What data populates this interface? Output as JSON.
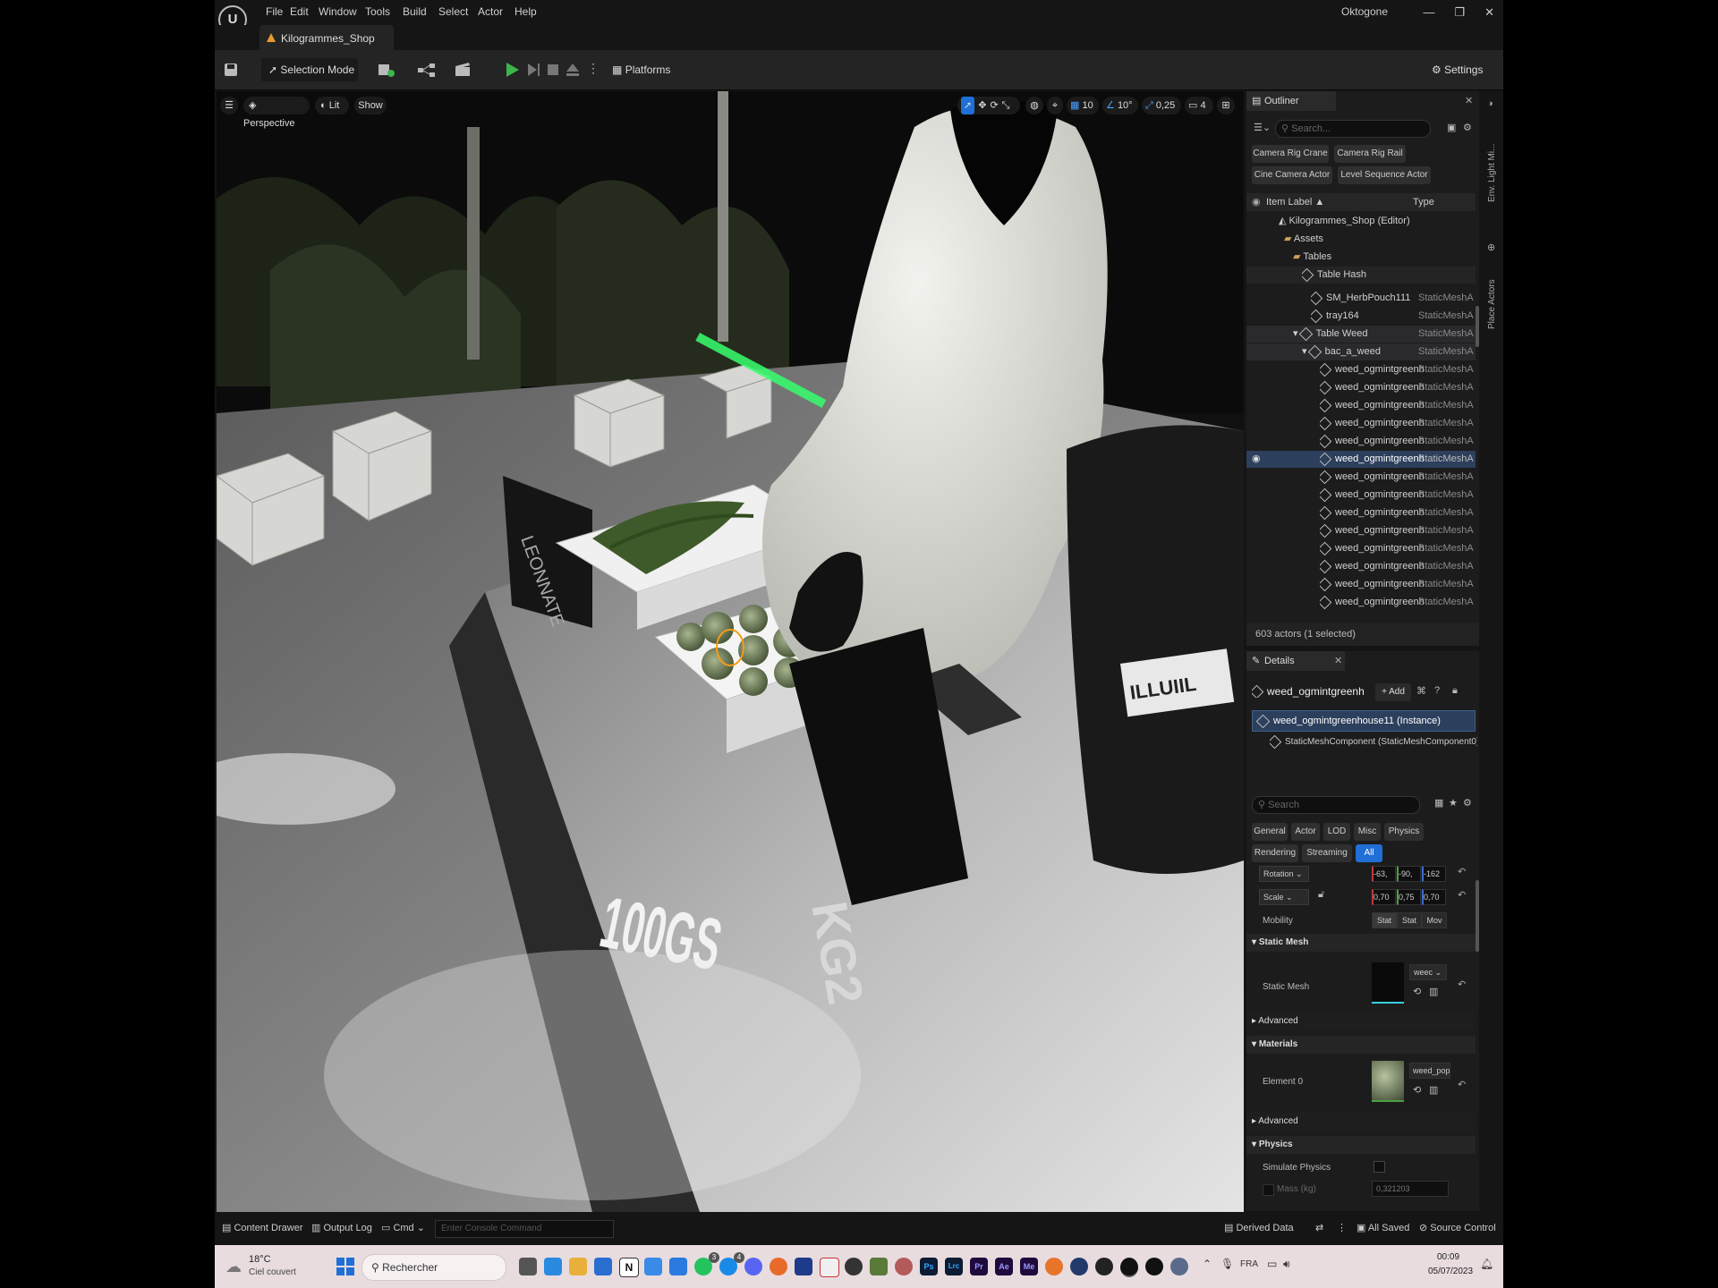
{
  "menubar": {
    "items": [
      "File",
      "Edit",
      "Window",
      "Tools",
      "Build",
      "Select",
      "Actor",
      "Help"
    ],
    "project": "Oktogone",
    "logo": "U"
  },
  "tab": {
    "level_name": "Kilogrammes_Shop"
  },
  "toolbar": {
    "selection_mode": "Selection Mode",
    "platforms": "Platforms",
    "settings": "Settings"
  },
  "viewport": {
    "perspective": "Perspective",
    "lit": "Lit",
    "show": "Show",
    "grid_snap": "10",
    "angle_snap": "10°",
    "scale_snap": "0,25",
    "camera_speed": "4",
    "bag_text": "100GS",
    "bag_text_lower": "KG2"
  },
  "outliner": {
    "title": "Outliner",
    "search_placeholder": "Search...",
    "filters": [
      "Camera Rig Crane",
      "Camera Rig Rail",
      "Cine Camera Actor",
      "Level Sequence Actor"
    ],
    "col_label": "Item Label ▲",
    "col_type": "Type",
    "rows": [
      {
        "label": "Kilogrammes_Shop (Editor)",
        "type": ""
      },
      {
        "label": "Assets",
        "type": ""
      },
      {
        "label": "Tables",
        "type": ""
      },
      {
        "label": "Table Hash",
        "type": ""
      },
      {
        "label": "SM_HerbPouch111",
        "type": "StaticMeshAc"
      },
      {
        "label": "tray164",
        "type": "StaticMeshAc"
      },
      {
        "label": "Table Weed",
        "type": "StaticMeshAc"
      },
      {
        "label": "bac_a_weed",
        "type": "StaticMeshAc"
      },
      {
        "label": "weed_ogmintgreenh",
        "type": "StaticMeshAc"
      },
      {
        "label": "weed_ogmintgreenh",
        "type": "StaticMeshAc"
      },
      {
        "label": "weed_ogmintgreenh",
        "type": "StaticMeshAc"
      },
      {
        "label": "weed_ogmintgreenh",
        "type": "StaticMeshAc"
      },
      {
        "label": "weed_ogmintgreenh",
        "type": "StaticMeshAc"
      },
      {
        "label": "weed_ogmintgreenh",
        "type": "StaticMeshAc"
      },
      {
        "label": "weed_ogmintgreenh",
        "type": "StaticMeshAc"
      },
      {
        "label": "weed_ogmintgreenh",
        "type": "StaticMeshAc"
      },
      {
        "label": "weed_ogmintgreenh",
        "type": "StaticMeshAc"
      },
      {
        "label": "weed_ogmintgreenh",
        "type": "StaticMeshAc"
      },
      {
        "label": "weed_ogmintgreenh",
        "type": "StaticMeshAc"
      },
      {
        "label": "weed_ogmintgreenh",
        "type": "StaticMeshAc"
      },
      {
        "label": "weed_ogmintgreenh",
        "type": "StaticMeshAc"
      },
      {
        "label": "weed_ogmintgreenh",
        "type": "StaticMeshAc"
      }
    ],
    "actor_count": "603 actors (1 selected)"
  },
  "details": {
    "title": "Details",
    "actor_name": "weed_ogmintgreenh",
    "add_label": "+ Add",
    "instance": "weed_ogmintgreenhouse11 (Instance)",
    "component": "StaticMeshComponent (StaticMeshComponent0)",
    "search_placeholder": "Search",
    "filter_tabs": [
      "General",
      "Actor",
      "LOD",
      "Misc",
      "Physics",
      "Rendering",
      "Streaming",
      "All"
    ],
    "rotation_label": "Rotation",
    "rotation": [
      "-63,",
      "-90,",
      "-162"
    ],
    "scale_label": "Scale",
    "scale": [
      "0,70",
      "0,75",
      "0,70"
    ],
    "mobility_label": "Mobility",
    "mobility": [
      "Stat",
      "Stat",
      "Mov"
    ],
    "sec_static_mesh": "Static Mesh",
    "static_mesh_label": "Static Mesh",
    "static_mesh_value": "weec",
    "advanced": "Advanced",
    "sec_materials": "Materials",
    "element0_label": "Element 0",
    "element0_value": "weed_popc",
    "advanced2": "Advanced",
    "sec_physics": "Physics",
    "simulate_physics": "Simulate Physics",
    "mass_label": "Mass (kg)",
    "mass_value": "0,321203"
  },
  "right_strip": {
    "env_light": "Env. Light Mi...",
    "place_actors": "Place Actors"
  },
  "statusbar": {
    "content_drawer": "Content Drawer",
    "output_log": "Output Log",
    "cmd": "Cmd",
    "console_placeholder": "Enter Console Command",
    "derived_data": "Derived Data",
    "all_saved": "All Saved",
    "source_control": "Source Control"
  },
  "taskbar": {
    "temp": "18°C",
    "weather": "Ciel couvert",
    "search": "Rechercher",
    "lang": "FRA",
    "time": "00:09",
    "date": "05/07/2023",
    "badges": [
      "3",
      "4"
    ],
    "app_labels": [
      "N",
      "Ps",
      "Lrc",
      "Pr",
      "Ae",
      "Me"
    ]
  },
  "colors": {
    "accent": "#1f6fd6",
    "selected_row": "#2c3f5c",
    "play_green": "#3bb54a"
  }
}
